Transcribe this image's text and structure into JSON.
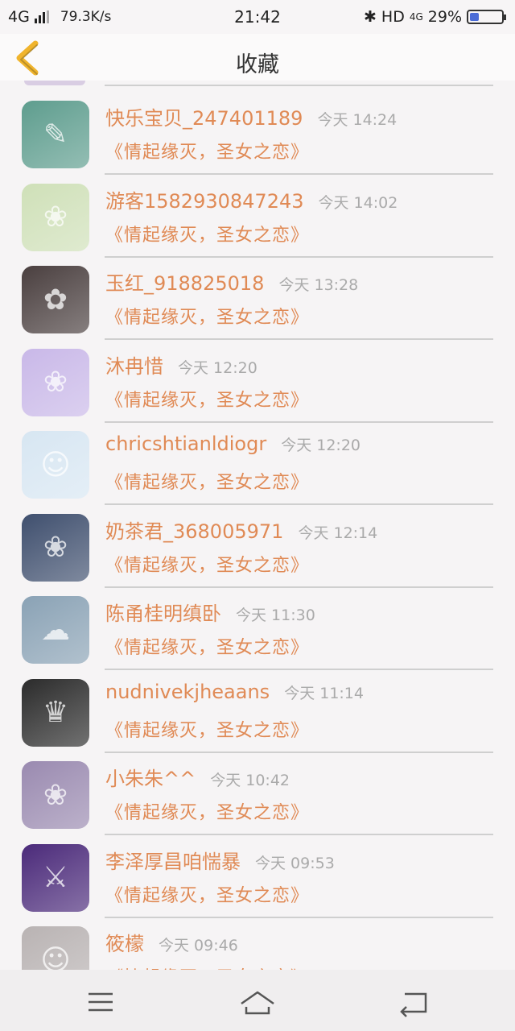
{
  "status": {
    "network": "4G",
    "speed": "79.3K/s",
    "time": "21:42",
    "bluetooth": "✱",
    "hd": "HD",
    "net2": "4G",
    "battery": "29%",
    "battery_level": 0.29
  },
  "header": {
    "title": "收藏",
    "back_icon": "chevron-left-icon",
    "accent": "#f0b42c"
  },
  "colors": {
    "accent_text": "#e08a55",
    "time_text": "#aaaaaa"
  },
  "items": [
    {
      "name": "快乐宝贝_247401189",
      "time": "今天 14:24",
      "book": "《情起缘灭，圣女之恋》",
      "avatar_color": "#5e9d8e",
      "avatar_icon": "text-wallpaper-icon"
    },
    {
      "name": "游客1582930847243",
      "time": "今天 14:02",
      "book": "《情起缘灭，圣女之恋》",
      "avatar_color": "#cfe0b8",
      "avatar_icon": "anime-girl-icon"
    },
    {
      "name": "玉红_918825018",
      "time": "今天 13:28",
      "book": "《情起缘灭，圣女之恋》",
      "avatar_color": "#4a3f3f",
      "avatar_icon": "fan-flowers-icon"
    },
    {
      "name": "沐冉惜",
      "time": "今天 12:20",
      "book": "《情起缘灭，圣女之恋》",
      "avatar_color": "#c9b8e8",
      "avatar_icon": "anime-girl-icon"
    },
    {
      "name": "chricshtianldiogr",
      "time": "今天 12:20",
      "book": "《情起缘灭，圣女之恋》",
      "avatar_color": "#d7e6f2",
      "avatar_icon": "boy-photo-icon"
    },
    {
      "name": "奶茶君_368005971",
      "time": "今天 12:14",
      "book": "《情起缘灭，圣女之恋》",
      "avatar_color": "#3f4f6e",
      "avatar_icon": "anime-girl-icon"
    },
    {
      "name": "陈甬桂明缜卧",
      "time": "今天 11:30",
      "book": "《情起缘灭，圣女之恋》",
      "avatar_color": "#8aa2b5",
      "avatar_icon": "landscape-icon"
    },
    {
      "name": "nudnivekjheaans",
      "time": "今天 11:14",
      "book": "《情起缘灭，圣女之恋》",
      "avatar_color": "#2b2b2b",
      "avatar_icon": "anime-boy-icon"
    },
    {
      "name": "小朱朱^^",
      "time": "今天 10:42",
      "book": "《情起缘灭，圣女之恋》",
      "avatar_color": "#9a8ab0",
      "avatar_icon": "anime-girl-icon"
    },
    {
      "name": "李泽厚昌咱惴暴",
      "time": "今天 09:53",
      "book": "《情起缘灭，圣女之恋》",
      "avatar_color": "#4b2a7a",
      "avatar_icon": "game-warrior-icon"
    },
    {
      "name": "筱檬",
      "time": "今天 09:46",
      "book": "《情起缘灭，圣女之恋》",
      "avatar_color": "#b9b3b3",
      "avatar_icon": "girl-photo-icon"
    }
  ],
  "bottom_nav": {
    "menu_icon": "menu-icon",
    "home_icon": "home-icon",
    "back_icon": "back-icon"
  }
}
